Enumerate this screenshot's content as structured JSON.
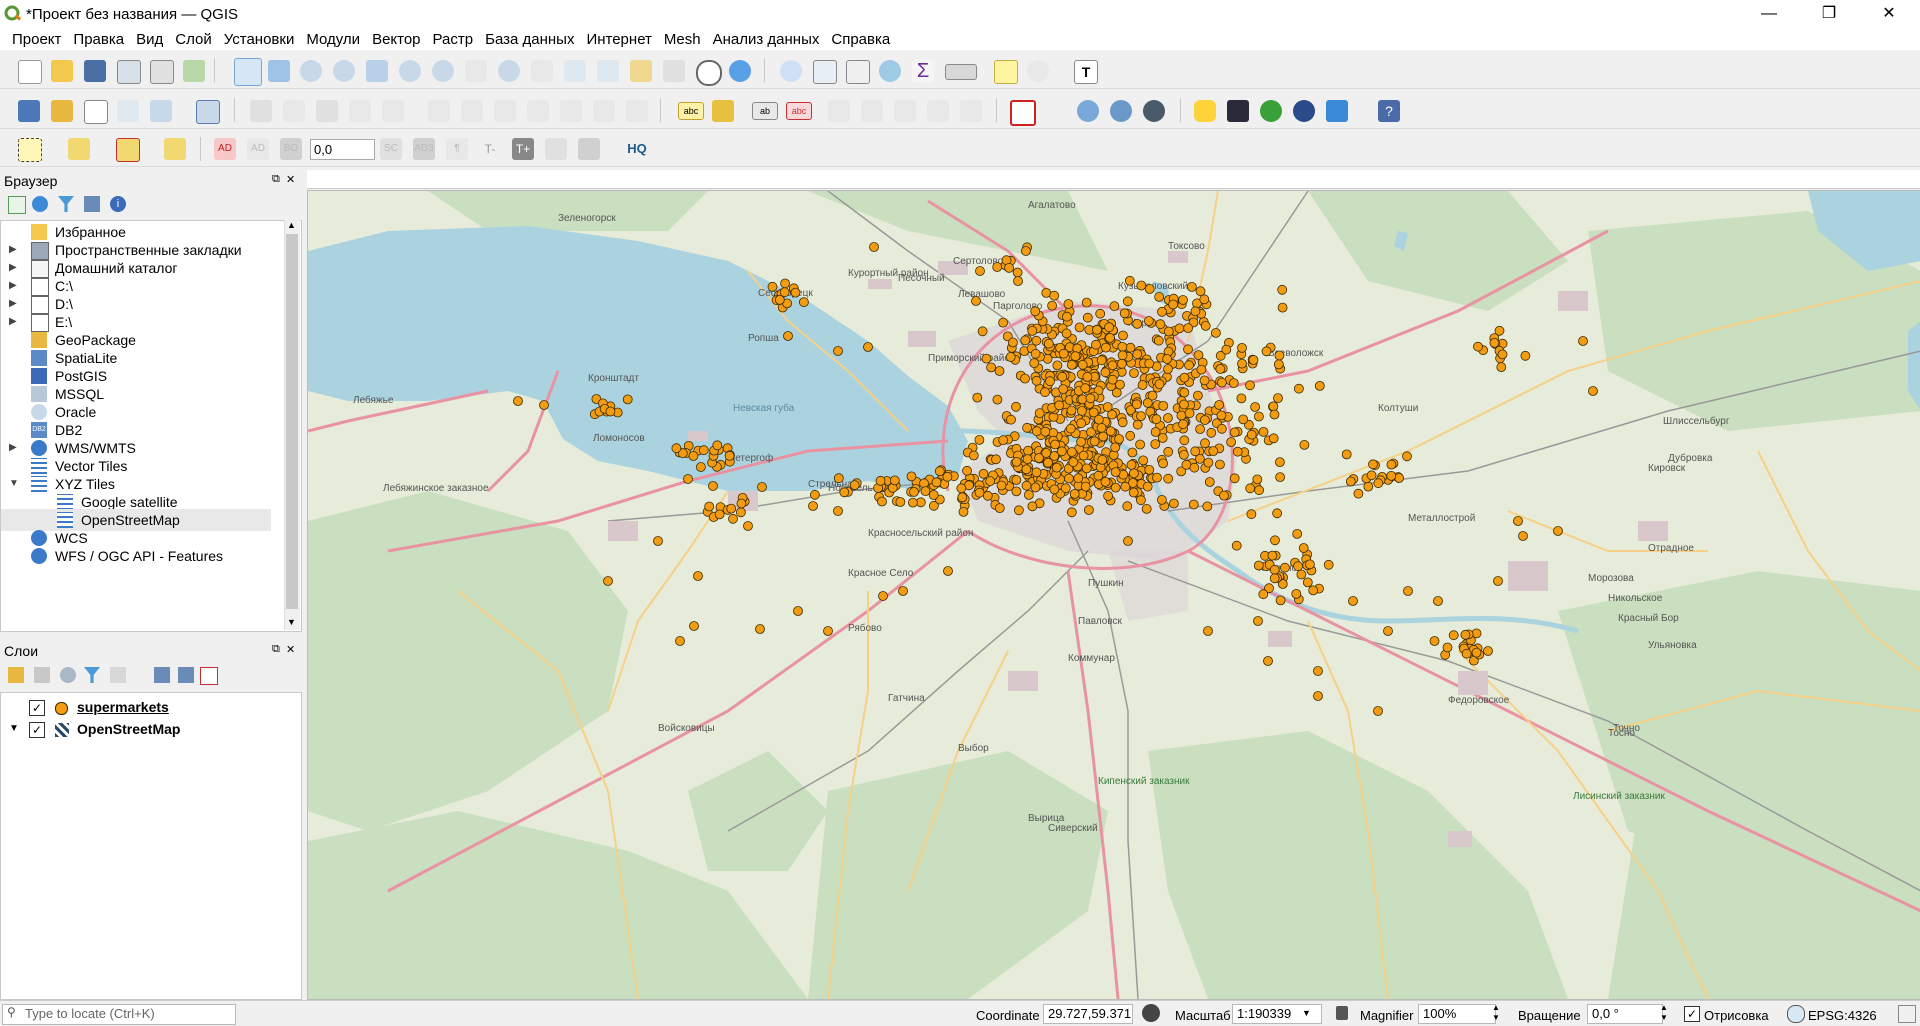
{
  "window": {
    "title": "*Проект без названия — QGIS",
    "controls": {
      "minimize": "—",
      "maximize": "❐",
      "close": "✕"
    }
  },
  "menu": [
    "Проект",
    "Правка",
    "Вид",
    "Слой",
    "Установки",
    "Модули",
    "Вектор",
    "Растр",
    "База данных",
    "Интернет",
    "Mesh",
    "Анализ данных",
    "Справка"
  ],
  "toolbar3": {
    "ad": "AD",
    "ad2": "AD",
    "label_size": "0,0",
    "ad3": "AD3",
    "t_minus": "T-",
    "t_plus": "T+",
    "hq": "HQ"
  },
  "toolbar2": {
    "abc1": "abc",
    "abc2": "abc"
  },
  "browser": {
    "title": "Браузер",
    "items": [
      {
        "label": "Избранное",
        "icon": "star-icon",
        "expand": false
      },
      {
        "label": "Пространственные закладки",
        "icon": "bookmark-icon",
        "expand": true
      },
      {
        "label": "Домашний каталог",
        "icon": "home-folder-icon",
        "expand": true
      },
      {
        "label": "C:\\",
        "icon": "folder-icon",
        "expand": true
      },
      {
        "label": "D:\\",
        "icon": "folder-icon",
        "expand": true
      },
      {
        "label": "E:\\",
        "icon": "folder-icon",
        "expand": true
      },
      {
        "label": "GeoPackage",
        "icon": "geopackage-icon",
        "expand": false
      },
      {
        "label": "SpatiaLite",
        "icon": "spatialite-icon",
        "expand": false
      },
      {
        "label": "PostGIS",
        "icon": "postgis-icon",
        "expand": false
      },
      {
        "label": "MSSQL",
        "icon": "mssql-icon",
        "expand": false
      },
      {
        "label": "Oracle",
        "icon": "oracle-icon",
        "expand": false
      },
      {
        "label": "DB2",
        "icon": "db2-icon",
        "expand": false
      },
      {
        "label": "WMS/WMTS",
        "icon": "globe-icon",
        "expand": true
      },
      {
        "label": "Vector Tiles",
        "icon": "grid-icon",
        "expand": false
      },
      {
        "label": "XYZ Tiles",
        "icon": "grid-icon",
        "expand": "open"
      },
      {
        "label": "Google satellite",
        "icon": "grid-icon",
        "child": true
      },
      {
        "label": "OpenStreetMap",
        "icon": "grid-icon",
        "child": true,
        "selected": true
      },
      {
        "label": "WCS",
        "icon": "globe-icon",
        "expand": false
      },
      {
        "label": "WFS / OGC API - Features",
        "icon": "globe-icon",
        "expand": false
      }
    ],
    "db2_badge": "DB2"
  },
  "layers": {
    "title": "Слои",
    "items": [
      {
        "label": "supermarkets",
        "checked": "✓",
        "icon": "point-symbol-icon"
      },
      {
        "label": "OpenStreetMap",
        "checked": "✓",
        "icon": "raster-tiles-icon"
      }
    ]
  },
  "locator": {
    "placeholder": "Type to locate (Ctrl+K)"
  },
  "map": {
    "labels": [
      "Зеленогорск",
      "Агалатово",
      "Курортный район",
      "Сертолово",
      "Песочный",
      "Токсово",
      "Кузьмоловский",
      "Парголово",
      "Левашово",
      "Сестрорецк",
      "Кронштадт",
      "Невская губа",
      "Лебяжье",
      "Приморский район",
      "Всеволожск",
      "Мурино",
      "Ломоносов",
      "Петергоф",
      "Красное Село",
      "Стрельна",
      "Пушкин",
      "Колпино",
      "Отрадное",
      "Никольское",
      "Коммунар",
      "Гатчина",
      "Федоровское",
      "Тосно",
      "Кировск",
      "Шлиссельбург",
      "Ульяновка",
      "Красный Бор",
      "Павловск",
      "Дубровка",
      "Точно",
      "Лисинский заказник",
      "Кипенский заказник",
      "Выбор",
      "Лебяжинское заказное",
      "Ропша",
      "Морозова",
      "Сиверский",
      "Рябово",
      "Вырица",
      "Красносельский район",
      "Новоселье",
      "Войсковицы",
      "Колтуши",
      "Металлострой"
    ]
  },
  "status": {
    "coordinate_label": "Coordinate",
    "coordinate_value": "29.727,59.371",
    "scale_label": "Масштаб",
    "scale_value": "1:190339",
    "magnifier_label": "Magnifier",
    "magnifier_value": "100%",
    "rotation_label": "Вращение",
    "rotation_value": "0,0 °",
    "render_label": "Отрисовка",
    "render_checked": "✓",
    "crs": "EPSG:4326"
  },
  "colors": {
    "water": "#aad3df",
    "land": "#e6ecd9",
    "forest": "#cadfbf",
    "urban": "#dcd4d8",
    "point": "#f39c12",
    "point_stroke": "#3a2a00",
    "road_major": "#e892a2",
    "road": "#f6d087",
    "rail": "#999999",
    "accent": "#3aa03a"
  }
}
